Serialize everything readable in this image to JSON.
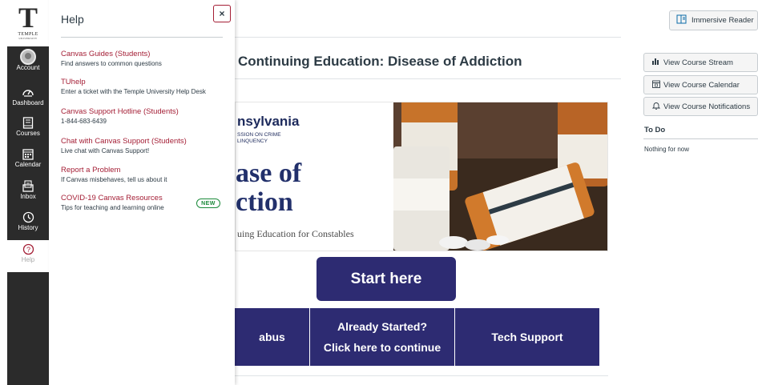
{
  "global_nav": {
    "logo_letter": "T",
    "logo_text": "TEMPLE",
    "logo_subtext": "UNIVERSITY",
    "items": [
      {
        "label": "Account",
        "icon": "avatar"
      },
      {
        "label": "Dashboard",
        "icon": "dashboard-icon"
      },
      {
        "label": "Courses",
        "icon": "courses-icon"
      },
      {
        "label": "Calendar",
        "icon": "calendar-icon"
      },
      {
        "label": "Inbox",
        "icon": "inbox-icon"
      },
      {
        "label": "History",
        "icon": "history-icon"
      },
      {
        "label": "Help",
        "icon": "help-icon",
        "active": true
      }
    ],
    "bg_color": "#2b2b2b",
    "accent_color": "#a41e35"
  },
  "help_tray": {
    "title": "Help",
    "close_label": "×",
    "links": [
      {
        "label": "Canvas Guides (Students)",
        "description": "Find answers to common questions"
      },
      {
        "label": "TUhelp",
        "description": "Enter a ticket with the Temple University Help Desk"
      },
      {
        "label": "Canvas Support Hotline (Students)",
        "description": "1-844-683-6439"
      },
      {
        "label": "Chat with Canvas Support (Students)",
        "description": "Live chat with Canvas Support!"
      },
      {
        "label": "Report a Problem",
        "description": "If Canvas misbehaves, tell us about it"
      },
      {
        "label": "COVID-19 Canvas Resources",
        "description": "Tips for teaching and learning online",
        "badge": "NEW"
      }
    ],
    "link_color": "#a41e35",
    "badge_color": "#1b8a3a"
  },
  "header": {
    "immersive_reader_label": "Immersive Reader"
  },
  "course": {
    "title": "Continuing Education: Disease of Addiction",
    "banner": {
      "org_name": "nsylvania",
      "org_line1": "SSION ON CRIME",
      "org_line2": "LINQUENCY",
      "headline1": "ase of",
      "headline2": "ction",
      "subtitle": "uing Education for Constables"
    },
    "start_label": "Start here",
    "tiles": [
      {
        "line1": "abus",
        "line2": ""
      },
      {
        "line1": "Already Started?",
        "line2": "Click here to continue"
      },
      {
        "line1": "Tech Support",
        "line2": ""
      }
    ],
    "tile_color": "#2d2b72"
  },
  "sidebar": {
    "buttons": [
      {
        "label": "View Course Stream",
        "icon": "bar-chart-icon"
      },
      {
        "label": "View Course Calendar",
        "icon": "calendar-icon"
      },
      {
        "label": "View Course Notifications",
        "icon": "bell-icon"
      }
    ],
    "todo_heading": "To Do",
    "todo_empty": "Nothing for now"
  }
}
